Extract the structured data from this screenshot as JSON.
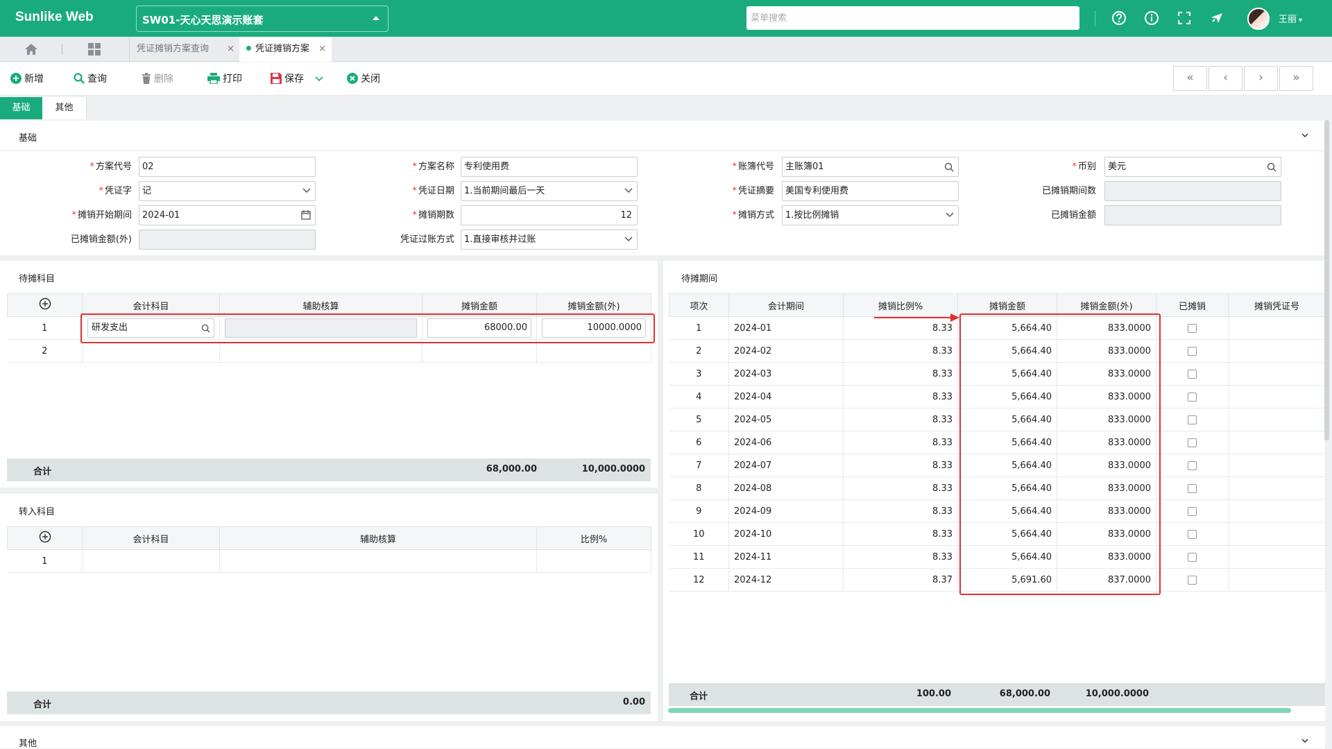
{
  "topbar": {
    "brand": "Sunlike Web",
    "account": "SW01-天心天思演示账套",
    "search_placeholder": "菜单搜索",
    "username": "王丽",
    "dropdown_glyph": "▾",
    "icons": [
      "help-icon",
      "info-icon",
      "fullscreen-icon",
      "notification-icon"
    ]
  },
  "tabs": [
    {
      "label": "凭证摊销方案查询",
      "active": false
    },
    {
      "label": "凭证摊销方案",
      "active": true
    }
  ],
  "toolbar": {
    "new": "新增",
    "query": "查询",
    "delete": "删除",
    "print": "打印",
    "save": "保存",
    "close": "关闭"
  },
  "nav": {
    "first": "«",
    "prev": "‹",
    "next": "›",
    "last": "»"
  },
  "subtabs": {
    "basic": "基础",
    "other": "其他"
  },
  "section_basic": "基础",
  "section_other": "其他",
  "form": {
    "plan_code": {
      "label": "方案代号",
      "value": "02"
    },
    "voucher_word": {
      "label": "凭证字",
      "value": "记"
    },
    "start_period": {
      "label": "摊销开始期间",
      "value": "2024-01"
    },
    "amortized_fx": {
      "label": "已摊销金额(外)",
      "value": ""
    },
    "plan_name": {
      "label": "方案名称",
      "value": "专利使用费"
    },
    "voucher_date": {
      "label": "凭证日期",
      "value": "1.当前期间最后一天"
    },
    "periods": {
      "label": "摊销期数",
      "value": "12"
    },
    "posting_mode": {
      "label": "凭证过账方式",
      "value": "1.直接审核并过账"
    },
    "ledger_code": {
      "label": "账簿代号",
      "value": "主账簿01"
    },
    "voucher_summary": {
      "label": "凭证摘要",
      "value": "美国专利使用费"
    },
    "method": {
      "label": "摊销方式",
      "value": "1.按比例摊销"
    },
    "currency": {
      "label": "币别",
      "value": "美元"
    },
    "amortized_periods": {
      "label": "已摊销期间数",
      "value": ""
    },
    "amortized_amount": {
      "label": "已摊销金额",
      "value": ""
    }
  },
  "pending_subjects": {
    "title": "待摊科目",
    "columns": [
      "会计科目",
      "辅助核算",
      "摊销金额",
      "摊销金额(外)"
    ],
    "rows": [
      {
        "no": "1",
        "subject": "研发支出",
        "aux": "",
        "amount": "68000.00",
        "amount_fx": "10000.0000"
      },
      {
        "no": "2",
        "subject": "",
        "aux": "",
        "amount": "",
        "amount_fx": ""
      }
    ],
    "total_label": "合计",
    "total_amount": "68,000.00",
    "total_amount_fx": "10,000.0000"
  },
  "transfer_subjects": {
    "title": "转入科目",
    "columns": [
      "会计科目",
      "辅助核算",
      "比例%"
    ],
    "rows": [
      {
        "no": "1",
        "subject": "",
        "aux": "",
        "ratio": ""
      }
    ],
    "total_label": "合计",
    "total_ratio": "0.00"
  },
  "pending_periods": {
    "title": "待摊期间",
    "columns": [
      "项次",
      "会计期间",
      "摊销比例%",
      "摊销金额",
      "摊销金额(外)",
      "已摊销",
      "摊销凭证号"
    ],
    "rows": [
      {
        "no": "1",
        "period": "2024-01",
        "ratio": "8.33",
        "amount": "5,664.40",
        "amount_fx": "833.0000"
      },
      {
        "no": "2",
        "period": "2024-02",
        "ratio": "8.33",
        "amount": "5,664.40",
        "amount_fx": "833.0000"
      },
      {
        "no": "3",
        "period": "2024-03",
        "ratio": "8.33",
        "amount": "5,664.40",
        "amount_fx": "833.0000"
      },
      {
        "no": "4",
        "period": "2024-04",
        "ratio": "8.33",
        "amount": "5,664.40",
        "amount_fx": "833.0000"
      },
      {
        "no": "5",
        "period": "2024-05",
        "ratio": "8.33",
        "amount": "5,664.40",
        "amount_fx": "833.0000"
      },
      {
        "no": "6",
        "period": "2024-06",
        "ratio": "8.33",
        "amount": "5,664.40",
        "amount_fx": "833.0000"
      },
      {
        "no": "7",
        "period": "2024-07",
        "ratio": "8.33",
        "amount": "5,664.40",
        "amount_fx": "833.0000"
      },
      {
        "no": "8",
        "period": "2024-08",
        "ratio": "8.33",
        "amount": "5,664.40",
        "amount_fx": "833.0000"
      },
      {
        "no": "9",
        "period": "2024-09",
        "ratio": "8.33",
        "amount": "5,664.40",
        "amount_fx": "833.0000"
      },
      {
        "no": "10",
        "period": "2024-10",
        "ratio": "8.33",
        "amount": "5,664.40",
        "amount_fx": "833.0000"
      },
      {
        "no": "11",
        "period": "2024-11",
        "ratio": "8.33",
        "amount": "5,664.40",
        "amount_fx": "833.0000"
      },
      {
        "no": "12",
        "period": "2024-12",
        "ratio": "8.37",
        "amount": "5,691.60",
        "amount_fx": "837.0000"
      }
    ],
    "total_label": "合计",
    "total_ratio": "100.00",
    "total_amount": "68,000.00",
    "total_amount_fx": "10,000.0000"
  },
  "colors": {
    "brand": "#1aab7c",
    "highlight_red": "#e03131",
    "footer_bg": "#dde3e3"
  }
}
